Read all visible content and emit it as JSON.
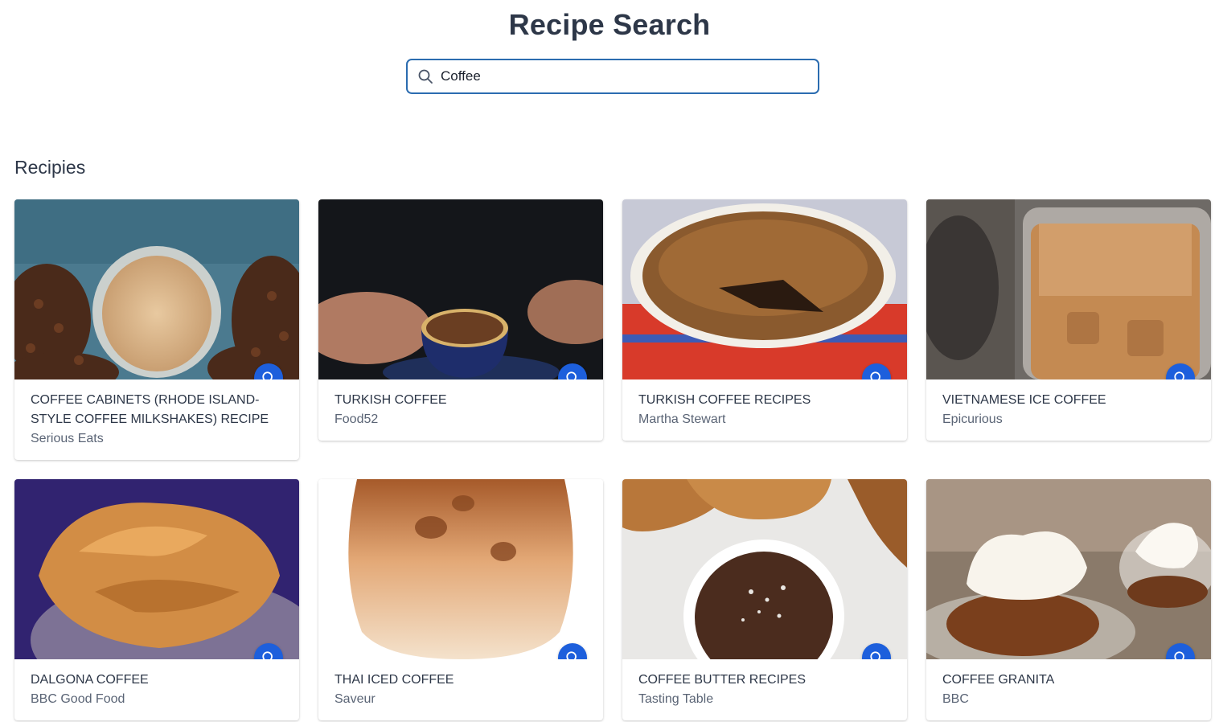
{
  "header": {
    "title": "Recipe Search"
  },
  "search": {
    "value": "Coffee",
    "placeholder": ""
  },
  "section": {
    "title": "Recipies"
  },
  "recipes": [
    {
      "title": "COFFEE CABINETS (RHODE ISLAND-STYLE COFFEE MILKSHAKES) RECIPE",
      "source": "Serious Eats"
    },
    {
      "title": "TURKISH COFFEE",
      "source": "Food52"
    },
    {
      "title": "TURKISH COFFEE RECIPES",
      "source": "Martha Stewart"
    },
    {
      "title": "VIETNAMESE ICE COFFEE",
      "source": "Epicurious"
    },
    {
      "title": "DALGONA COFFEE",
      "source": "BBC Good Food"
    },
    {
      "title": "THAI ICED COFFEE",
      "source": "Saveur"
    },
    {
      "title": "COFFEE BUTTER RECIPES",
      "source": "Tasting Table"
    },
    {
      "title": "COFFEE GRANITA",
      "source": "BBC"
    }
  ],
  "colors": {
    "accent": "#1d5fdc",
    "focus_border": "#2b6cb0",
    "text": "#2d3748"
  },
  "icons": {
    "search": "search-icon",
    "zoom": "zoom-icon"
  }
}
